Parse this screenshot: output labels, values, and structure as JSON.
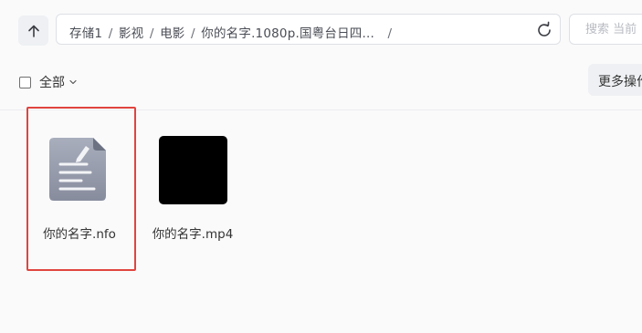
{
  "toolbar": {
    "up_icon": "arrow-up-icon",
    "path": {
      "segments": [
        "存储1",
        "影视",
        "电影",
        "你的名字.1080p.国粤台日四..."
      ],
      "separator": "/",
      "trailing": "/"
    },
    "refresh_icon": "refresh-icon",
    "search_placeholder": "搜索 当前"
  },
  "actions": {
    "select_all_label": "全部",
    "more_label": "更多操作"
  },
  "files": [
    {
      "name": "你的名字.nfo",
      "type": "document",
      "icon": "document-icon",
      "selected": true
    },
    {
      "name": "你的名字.mp4",
      "type": "video",
      "icon": "video-thumbnail",
      "selected": false
    }
  ],
  "colors": {
    "selection_border": "#e0443e",
    "button_bg": "#eef0f3",
    "doc_icon_gradient": [
      "#a7acbb",
      "#868b9c"
    ]
  }
}
